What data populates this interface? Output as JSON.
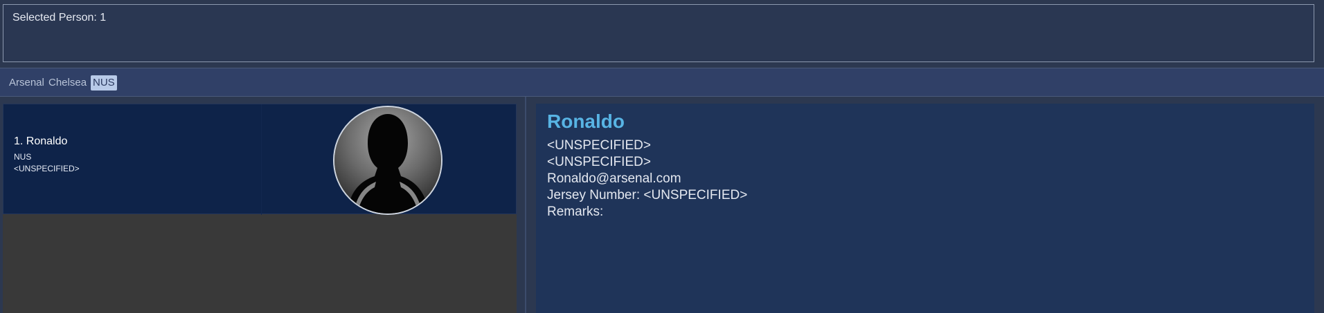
{
  "result": {
    "text": "Selected Person: 1"
  },
  "tags": [
    "Arsenal",
    "Chelsea",
    "NUS"
  ],
  "active_tag": "NUS",
  "person_card": {
    "index_name": "1.  Ronaldo",
    "tag": "NUS",
    "phone": "<UNSPECIFIED>",
    "avatar_icon": "person-silhouette-icon"
  },
  "details": {
    "name": "Ronaldo",
    "line1": "<UNSPECIFIED>",
    "line2": "<UNSPECIFIED>",
    "email": "Ronaldo@arsenal.com",
    "jersey": "Jersey Number: <UNSPECIFIED>",
    "remarks": "Remarks:"
  },
  "colors": {
    "background": "#2c3850",
    "card": "#0e2349",
    "detail_panel": "#1f3459",
    "name_accent": "#58b4e4",
    "active_tag_bg": "#b8cae8"
  }
}
